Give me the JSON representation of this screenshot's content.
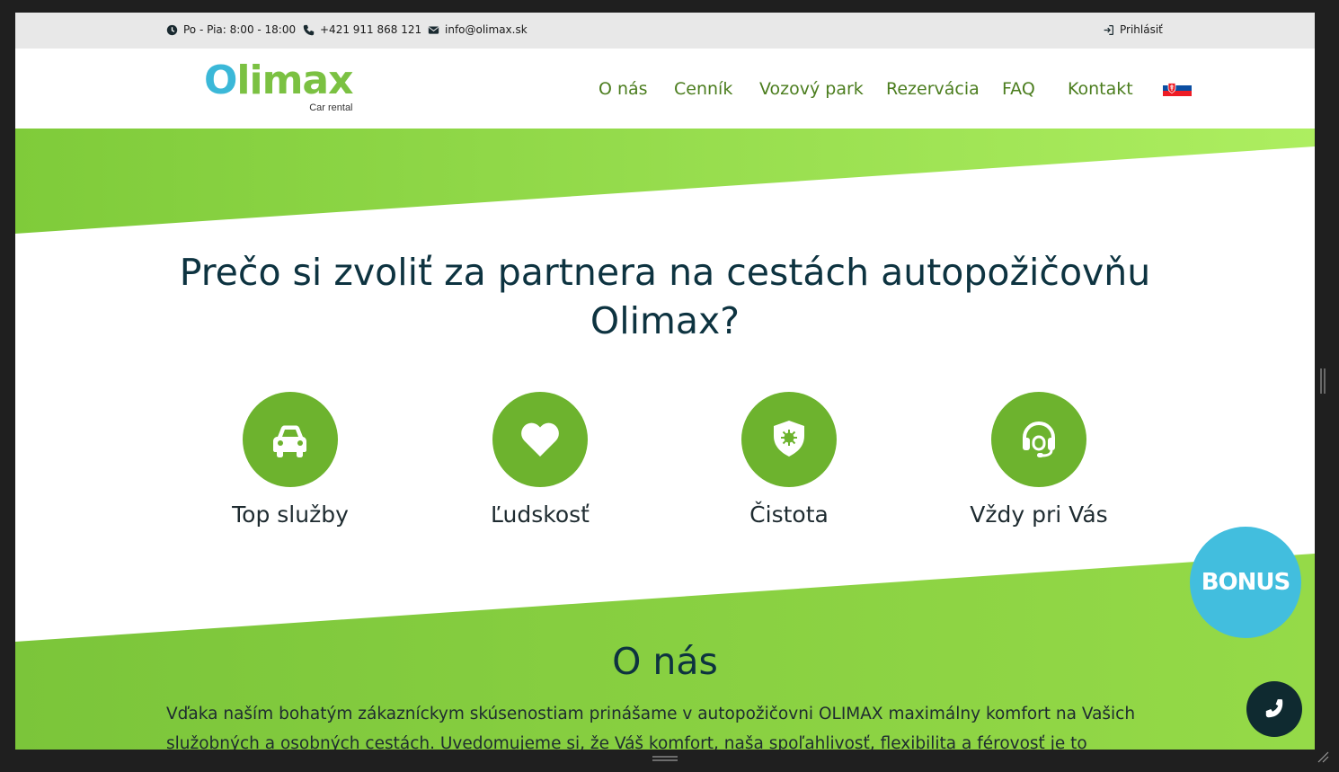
{
  "topbar": {
    "hours": "Po - Pia: 8:00 - 18:00",
    "phone": "+421 911 868 121",
    "email": "info@olimax.sk",
    "login": "Prihlásiť"
  },
  "logo": {
    "o": "O",
    "rest": "limax",
    "sub": "Car rental"
  },
  "nav": [
    "O nás",
    "Cenník",
    "Vozový park",
    "Rezervácia",
    "FAQ",
    "Kontakt"
  ],
  "hero": {
    "title": "Prečo si zvoliť za partnera na cestách autopožičovňu Olimax?"
  },
  "features": [
    {
      "label": "Top služby",
      "icon": "car-icon"
    },
    {
      "label": "Ľudskosť",
      "icon": "heart-icon"
    },
    {
      "label": "Čistota",
      "icon": "shield-virus-icon"
    },
    {
      "label": "Vždy pri Vás",
      "icon": "headset-icon"
    }
  ],
  "about": {
    "title": "O nás",
    "text": "Vďaka naším bohatým zákazníckym skúsenostiam prinášame v autopožičovni OLIMAX maximálny komfort na Vašich služobných a osobných cestách. Uvedomujeme si, že Váš komfort, naša spoľahlivosť, flexibilita a férovosť je to najdôležitejšie pre Vašu"
  },
  "bonus": "BONUS",
  "colors": {
    "green": "#6db32e",
    "dark": "#0d3340",
    "blue": "#42bede"
  }
}
